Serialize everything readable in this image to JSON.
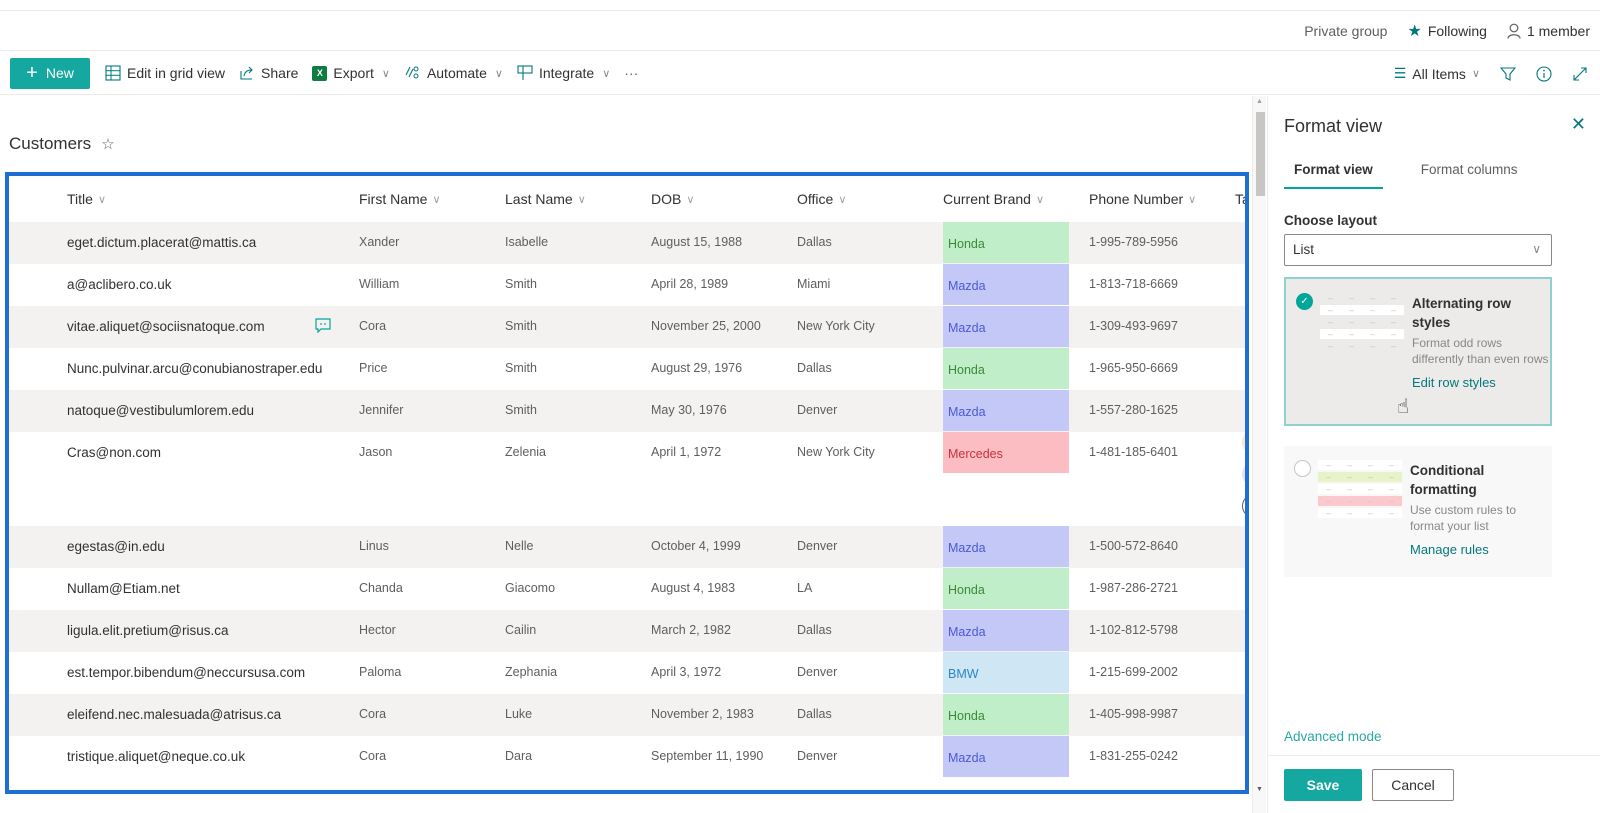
{
  "group_bar": {
    "privacy": "Private group",
    "following": "Following",
    "members": "1 member"
  },
  "command_bar": {
    "new_label": "New",
    "edit_grid_label": "Edit in grid view",
    "share_label": "Share",
    "export_label": "Export",
    "automate_label": "Automate",
    "integrate_label": "Integrate",
    "more_label": "···",
    "view_label": "All Items"
  },
  "list": {
    "title": "Customers",
    "columns": [
      "Title",
      "First Name",
      "Last Name",
      "DOB",
      "Office",
      "Current Brand",
      "Phone Number",
      "Ta"
    ],
    "rows": [
      {
        "title": "eget.dictum.placerat@mattis.ca",
        "first": "Xander",
        "last": "Isabelle",
        "dob": "August 15, 1988",
        "office": "Dallas",
        "brand": "Honda",
        "phone": "1-995-789-5956"
      },
      {
        "title": "a@aclibero.co.uk",
        "first": "William",
        "last": "Smith",
        "dob": "April 28, 1989",
        "office": "Miami",
        "brand": "Mazda",
        "phone": "1-813-718-6669"
      },
      {
        "title": "vitae.aliquet@sociisnatoque.com",
        "first": "Cora",
        "last": "Smith",
        "dob": "November 25, 2000",
        "office": "New York City",
        "brand": "Mazda",
        "phone": "1-309-493-9697",
        "has_comment": true
      },
      {
        "title": "Nunc.pulvinar.arcu@conubianostraper.edu",
        "first": "Price",
        "last": "Smith",
        "dob": "August 29, 1976",
        "office": "Dallas",
        "brand": "Honda",
        "phone": "1-965-950-6669"
      },
      {
        "title": "natoque@vestibulumlorem.edu",
        "first": "Jennifer",
        "last": "Smith",
        "dob": "May 30, 1976",
        "office": "Denver",
        "brand": "Mazda",
        "phone": "1-557-280-1625"
      },
      {
        "title": "Cras@non.com",
        "first": "Jason",
        "last": "Zelenia",
        "dob": "April 1, 1972",
        "office": "New York City",
        "brand": "Mercedes",
        "phone": "1-481-185-6401"
      },
      {
        "title": "egestas@in.edu",
        "first": "Linus",
        "last": "Nelle",
        "dob": "October 4, 1999",
        "office": "Denver",
        "brand": "Mazda",
        "phone": "1-500-572-8640"
      },
      {
        "title": "Nullam@Etiam.net",
        "first": "Chanda",
        "last": "Giacomo",
        "dob": "August 4, 1983",
        "office": "LA",
        "brand": "Honda",
        "phone": "1-987-286-2721"
      },
      {
        "title": "ligula.elit.pretium@risus.ca",
        "first": "Hector",
        "last": "Cailin",
        "dob": "March 2, 1982",
        "office": "Dallas",
        "brand": "Mazda",
        "phone": "1-102-812-5798"
      },
      {
        "title": "est.tempor.bibendum@neccursusa.com",
        "first": "Paloma",
        "last": "Zephania",
        "dob": "April 3, 1972",
        "office": "Denver",
        "brand": "BMW",
        "phone": "1-215-699-2002"
      },
      {
        "title": "eleifend.nec.malesuada@atrisus.ca",
        "first": "Cora",
        "last": "Luke",
        "dob": "November 2, 1983",
        "office": "Dallas",
        "brand": "Honda",
        "phone": "1-405-998-9987"
      },
      {
        "title": "tristique.aliquet@neque.co.uk",
        "first": "Cora",
        "last": "Dara",
        "dob": "September 11, 1990",
        "office": "Denver",
        "brand": "Mazda",
        "phone": "1-831-255-0242"
      }
    ],
    "brand_colors": {
      "Honda": {
        "bg": "#c0eec8",
        "fg": "#3a8a3a"
      },
      "Mazda": {
        "bg": "#c3c8f7",
        "fg": "#4a5ad6"
      },
      "Mercedes": {
        "bg": "#fbbcc2",
        "fg": "#c8343f"
      },
      "BMW": {
        "bg": "#cfe6f5",
        "fg": "#2a86c9"
      }
    }
  },
  "panel": {
    "title": "Format view",
    "tabs": [
      {
        "label": "Format view",
        "active": true
      },
      {
        "label": "Format columns",
        "active": false
      }
    ],
    "layout_label": "Choose layout",
    "layout_value": "List",
    "options": [
      {
        "heading": "Alternating row styles",
        "description": "Format odd rows differently than even rows",
        "link": "Edit row styles",
        "selected": true
      },
      {
        "heading": "Conditional formatting",
        "description": "Use custom rules to format your list",
        "link": "Manage rules",
        "selected": false
      }
    ],
    "advanced_mode": "Advanced mode",
    "save_label": "Save",
    "cancel_label": "Cancel"
  },
  "colors": {
    "accent": "#03a69a",
    "selection_border": "#1e6fd1"
  }
}
